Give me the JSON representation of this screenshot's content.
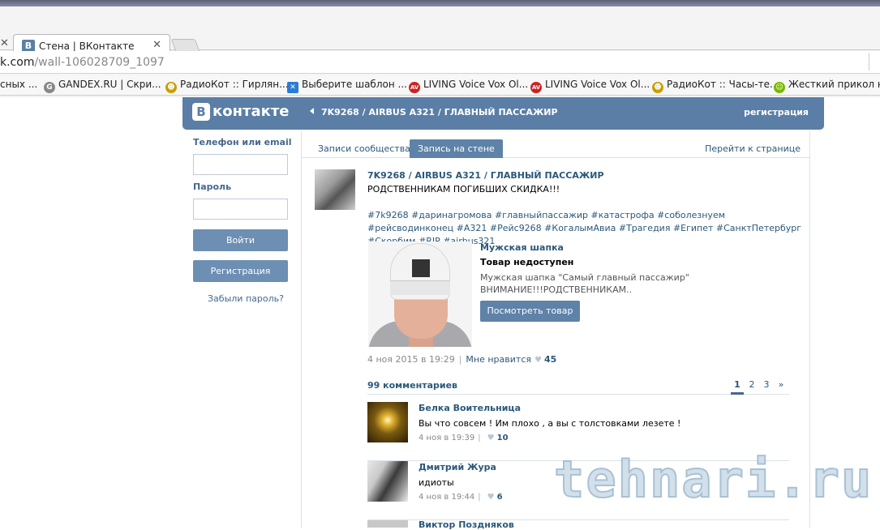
{
  "browser": {
    "tab_title": "Стена | ВКонтакте",
    "tab_icon_letter": "В",
    "url_host": "k.com",
    "url_path": "/wall-106028709_1097",
    "bookmarks": [
      {
        "label": "сных ...",
        "icon": "",
        "color": ""
      },
      {
        "label": "GANDEX.RU | Скри...",
        "icon": "G",
        "color": "#888888"
      },
      {
        "label": "РадиоКот :: Гирлян...",
        "icon": "☻",
        "color": "#c8a000"
      },
      {
        "label": "Выберите шаблон ...",
        "icon": "✕",
        "color": "#2a7bd6"
      },
      {
        "label": "LIVING Voice Vox Ol...",
        "icon": "AV",
        "color": "#cc2222"
      },
      {
        "label": "LIVING Voice Vox Ol...",
        "icon": "AV",
        "color": "#cc2222"
      },
      {
        "label": "РадиоКот :: Часы-те...",
        "icon": "☻",
        "color": "#c8a000"
      },
      {
        "label": "Жесткий прикол на...",
        "icon": "☺",
        "color": "#7ab800"
      }
    ]
  },
  "header": {
    "logo_letter": "В",
    "logo_text": "контакте",
    "breadcrumb": "7K9268 / AIRBUS A321 / ГЛАВНЫЙ ПАССАЖИР",
    "register": "регистрация",
    "brand_color": "#5a7ea6"
  },
  "login": {
    "phone_label": "Телефон или email",
    "password_label": "Пароль",
    "login_button": "Войти",
    "register_button": "Регистрация",
    "forgot": "Забыли пароль?"
  },
  "tabs": {
    "community_posts": "Записи сообщества",
    "wall_post": "Запись на стене",
    "goto_page": "Перейти к странице"
  },
  "post": {
    "author": "7K9268 / AIRBUS A321 / ГЛАВНЫЙ ПАССАЖИР",
    "text": "РОДСТВЕННИКАМ ПОГИБШИХ СКИДКА!!!",
    "tags": "#7k9268 #даринагромова #главныйпассажир #катастрофа #соболезнуем #рейсводинконец #А321 #Рейс9268 #КогалымАвиа #Трагедия #Египет #СанктПетербург #Скорбим #RIP #airbus321",
    "date": "4 ноя 2015 в 19:29",
    "like_label": "Мне нравится",
    "likes": "45"
  },
  "product": {
    "title": "Мужская шапка",
    "status": "Товар недоступен",
    "desc_line1": "Мужская шапка \"Самый главный пассажир\"",
    "desc_line2": "ВНИМАНИЕ!!!РОДСТВЕННИКАМ..",
    "button": "Посмотреть товар"
  },
  "comments": {
    "count_label": "99 комментариев",
    "pages": [
      "1",
      "2",
      "3",
      "»"
    ],
    "items": [
      {
        "author": "Белка Воительница",
        "text": "Вы что совсем ! Им плохо , а вы с толстовками лезете !",
        "date": "4 ноя в 19:39",
        "likes": "10"
      },
      {
        "author": "Дмитрий Жура",
        "text": "идиоты",
        "date": "4 ноя в 19:44",
        "likes": "6"
      },
      {
        "author": "Виктор Поздняков",
        "text": "",
        "date": "",
        "likes": ""
      }
    ]
  },
  "watermark": "tehnari.ru"
}
